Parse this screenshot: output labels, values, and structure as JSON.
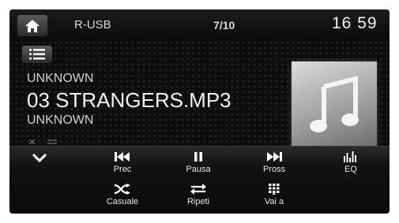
{
  "header": {
    "source": "R-USB",
    "track_position": "7/10",
    "clock": "16 59",
    "home_icon": "home-icon"
  },
  "now_playing": {
    "artist": "UNKNOWN",
    "title": "03 STRANGERS.MP3",
    "album": "UNKNOWN",
    "list_icon": "list-icon",
    "album_art_icon": "music-note-icon"
  },
  "controls": {
    "collapse_icon": "chevron-down-icon",
    "prev_label": "Prec",
    "pause_label": "Pausa",
    "next_label": "Pross",
    "eq_label": "EQ",
    "shuffle_label": "Casuale",
    "repeat_label": "Ripeti",
    "goto_label": "Vai a"
  }
}
